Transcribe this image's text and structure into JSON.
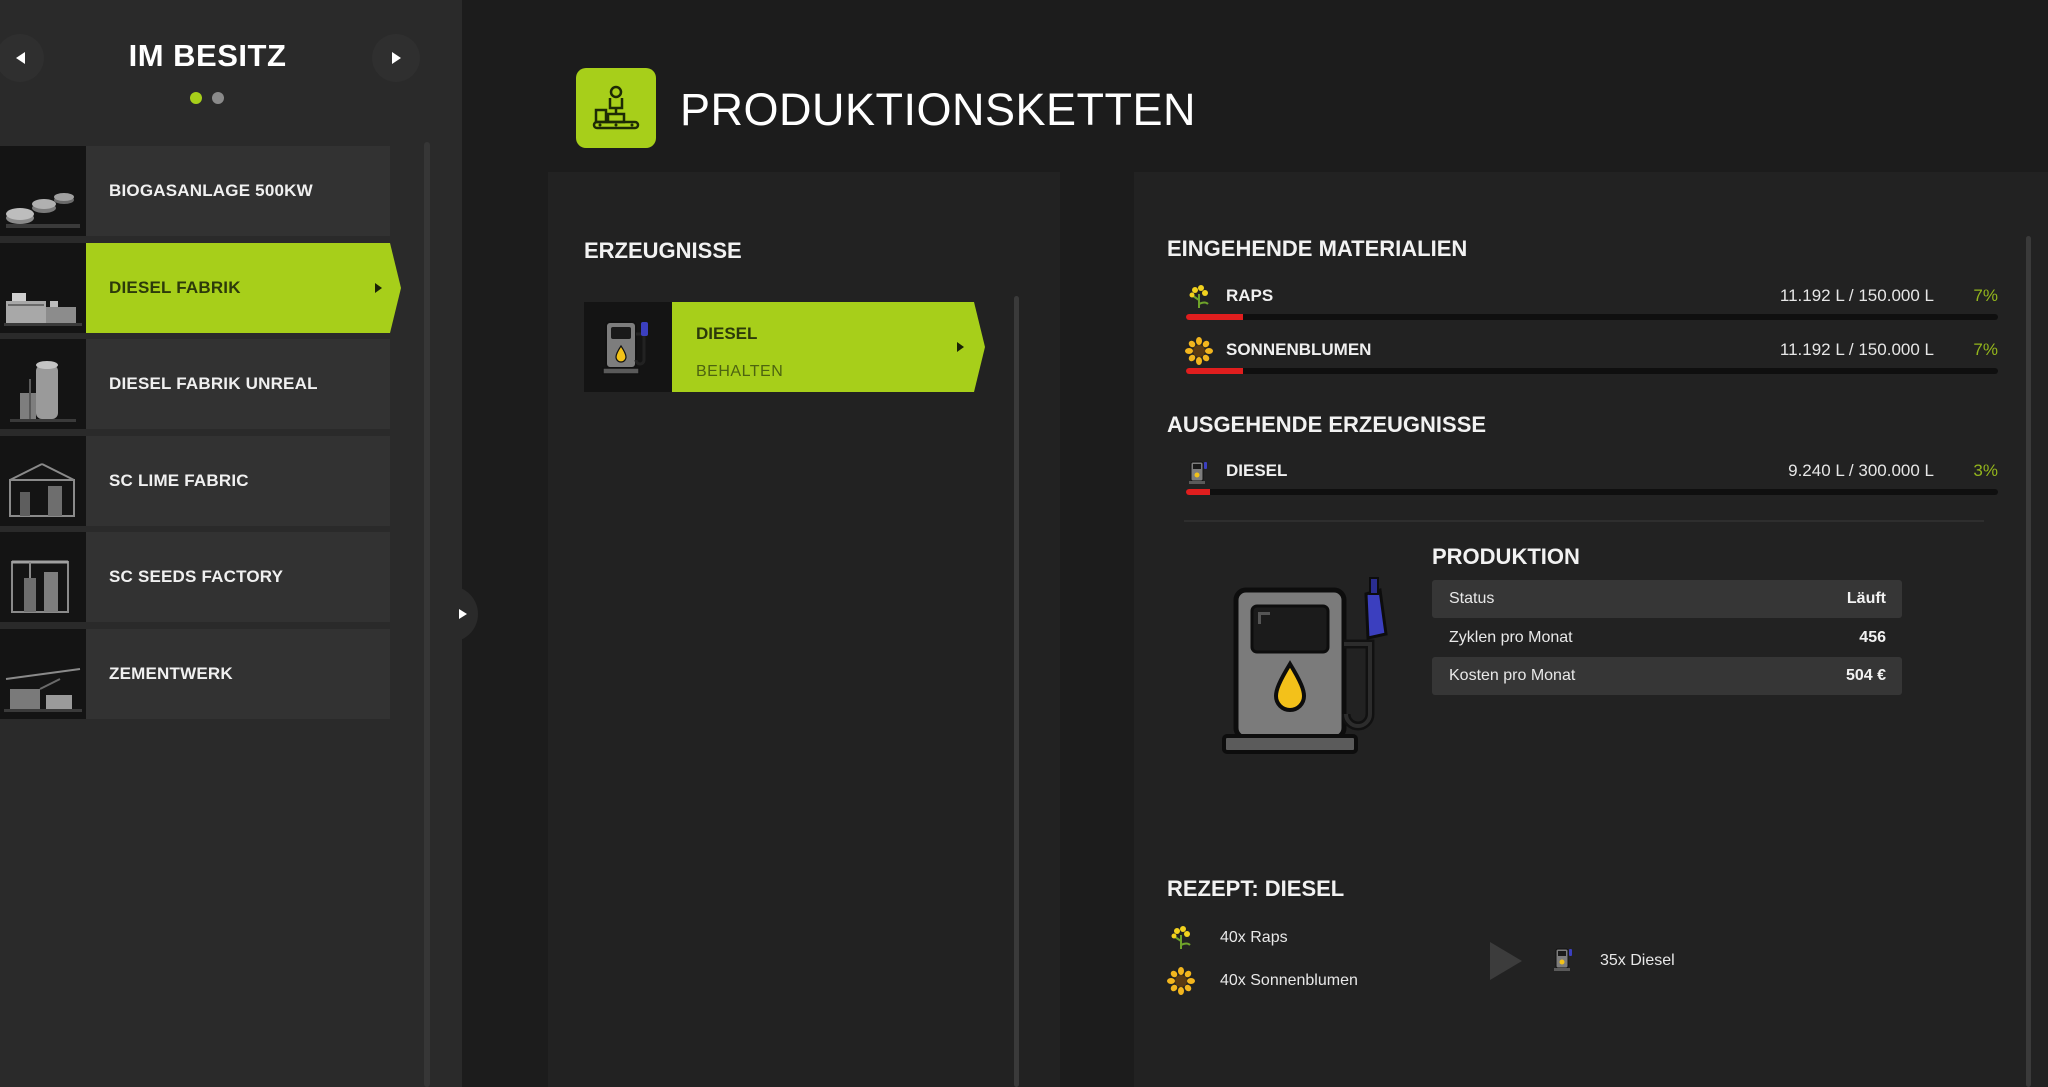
{
  "sidebar": {
    "title": "IM BESITZ",
    "page_count": 2,
    "active_page": 1,
    "items": [
      {
        "label": "BIOGASANLAGE 500KW",
        "selected": false
      },
      {
        "label": "DIESEL FABRIK",
        "selected": true
      },
      {
        "label": "DIESEL FABRIK UNREAL",
        "selected": false
      },
      {
        "label": "SC LIME FABRIC",
        "selected": false
      },
      {
        "label": "SC SEEDS FACTORY",
        "selected": false
      },
      {
        "label": "ZEMENTWERK",
        "selected": false
      }
    ]
  },
  "header": {
    "title": "PRODUKTIONSKETTEN",
    "icon": "production-chain-icon"
  },
  "products": {
    "heading": "ERZEUGNISSE",
    "items": [
      {
        "name": "DIESEL",
        "mode": "BEHALTEN",
        "icon": "fuel-pump-icon"
      }
    ]
  },
  "details": {
    "incoming": {
      "heading": "EINGEHENDE MATERIALIEN",
      "items": [
        {
          "name": "RAPS",
          "amount": "11.192 L / 150.000 L",
          "percent": "7%",
          "fill": 0.07,
          "icon": "canola-icon"
        },
        {
          "name": "SONNENBLUMEN",
          "amount": "11.192 L / 150.000 L",
          "percent": "7%",
          "fill": 0.07,
          "icon": "sunflower-icon"
        }
      ]
    },
    "outgoing": {
      "heading": "AUSGEHENDE ERZEUGNISSE",
      "items": [
        {
          "name": "DIESEL",
          "amount": "9.240 L / 300.000 L",
          "percent": "3%",
          "fill": 0.03,
          "icon": "diesel-icon"
        }
      ]
    },
    "production": {
      "heading": "PRODUKTION",
      "rows": [
        {
          "label": "Status",
          "value": "Läuft"
        },
        {
          "label": "Zyklen pro Monat",
          "value": "456"
        },
        {
          "label": "Kosten pro Monat",
          "value": "504 €"
        }
      ]
    },
    "recipe": {
      "heading": "REZEPT: DIESEL",
      "inputs": [
        {
          "text": "40x Raps",
          "icon": "canola-icon"
        },
        {
          "text": "40x Sonnenblumen",
          "icon": "sunflower-icon"
        }
      ],
      "output": {
        "text": "35x Diesel",
        "icon": "diesel-icon"
      }
    }
  },
  "colors": {
    "accent": "#a7cf1a",
    "fill_bar": "#e01e1e",
    "percent_text": "#93b51c",
    "background": "#1c1c1c",
    "panel": "#222222"
  }
}
